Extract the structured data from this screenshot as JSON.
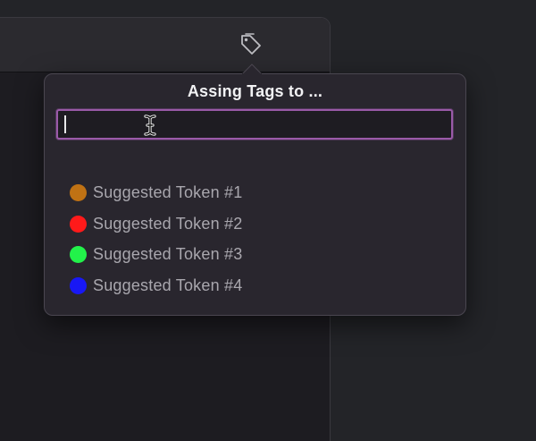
{
  "popover": {
    "title": "Assing Tags to ...",
    "input": {
      "value": "",
      "accent_color": "#9a5aa8"
    },
    "suggestions": [
      {
        "label": "Suggested Token #1",
        "color": "#c07214"
      },
      {
        "label": "Suggested Token #2",
        "color": "#ff1a1a"
      },
      {
        "label": "Suggested Token #3",
        "color": "#22f24a"
      },
      {
        "label": "Suggested Token #4",
        "color": "#1818f5"
      }
    ]
  },
  "toolbar": {
    "tag_button_icon": "tag-icon"
  }
}
